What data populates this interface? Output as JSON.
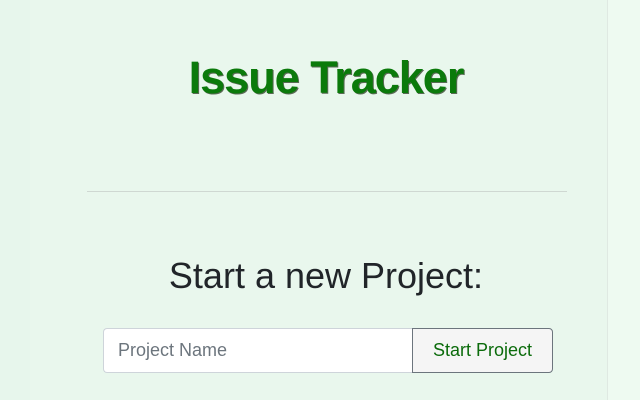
{
  "header": {
    "title": "Issue Tracker"
  },
  "new_project": {
    "heading": "Start a new Project:",
    "input": {
      "value": "",
      "placeholder": "Project Name"
    },
    "submit_label": "Start Project"
  },
  "colors": {
    "page_background": "#e9f7ed",
    "title_green": "#0b7a0b",
    "button_text_green": "#0b6b0b",
    "heading_text": "#212529",
    "divider": "#cfd8d2"
  }
}
